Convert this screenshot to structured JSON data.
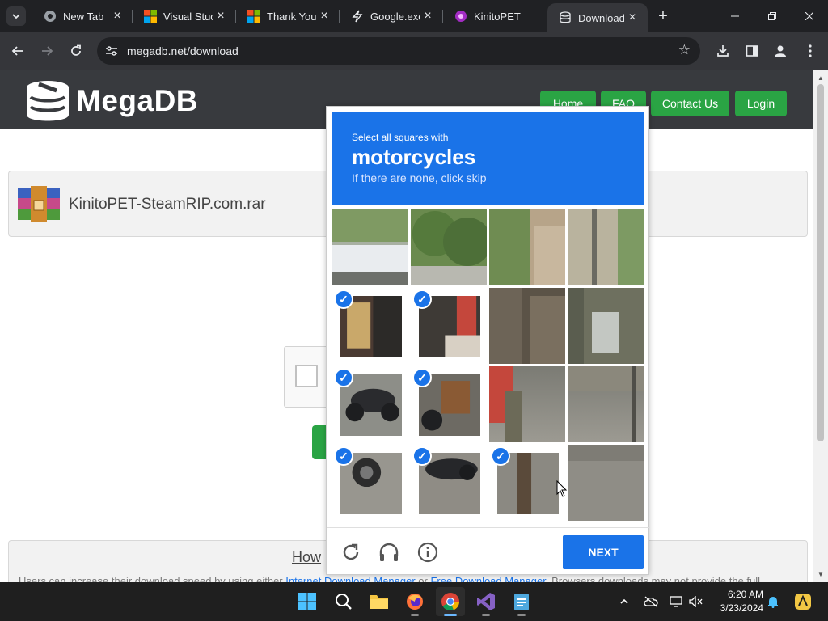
{
  "browser": {
    "tabs": [
      {
        "title": "New Tab",
        "icon": "chrome-icon"
      },
      {
        "title": "Visual Studio",
        "icon": "microsoft-icon"
      },
      {
        "title": "Thank You",
        "icon": "microsoft-icon"
      },
      {
        "title": "Google.exe",
        "icon": "lightning-icon"
      },
      {
        "title": "KinitoPET",
        "icon": "purple-app-icon"
      },
      {
        "title": "Download",
        "icon": "database-icon"
      }
    ],
    "active_tab_index": 5,
    "url": "megadb.net/download"
  },
  "site": {
    "logo_text": "MegaDB",
    "nav": [
      "Home",
      "FAQ",
      "Contact Us",
      "Login"
    ],
    "file_name": "KinitoPET-SteamRIP.com.rar",
    "how_title": "How",
    "how_text_prefix": "Users can increase their download speed by using either ",
    "how_link1": "Internet Download Manager",
    "how_text_mid": " or ",
    "how_link2": "Free Download Manager",
    "how_text_suffix": ". Browsers downloads may not provide the full"
  },
  "captcha": {
    "instruction_line1": "Select all squares with",
    "target": "motorcycles",
    "instruction_line3": "If there are none, click skip",
    "next_label": "NEXT",
    "check_glyph": "✓",
    "tiles": [
      [
        false,
        false,
        false,
        false
      ],
      [
        true,
        true,
        false,
        false
      ],
      [
        true,
        true,
        false,
        false
      ],
      [
        true,
        true,
        true,
        false
      ]
    ]
  },
  "taskbar": {
    "time": "6:20 AM",
    "date": "3/23/2024"
  },
  "colors": {
    "accent_blue": "#1a73e8",
    "site_green": "#2aa444",
    "site_header": "#383a3e"
  }
}
